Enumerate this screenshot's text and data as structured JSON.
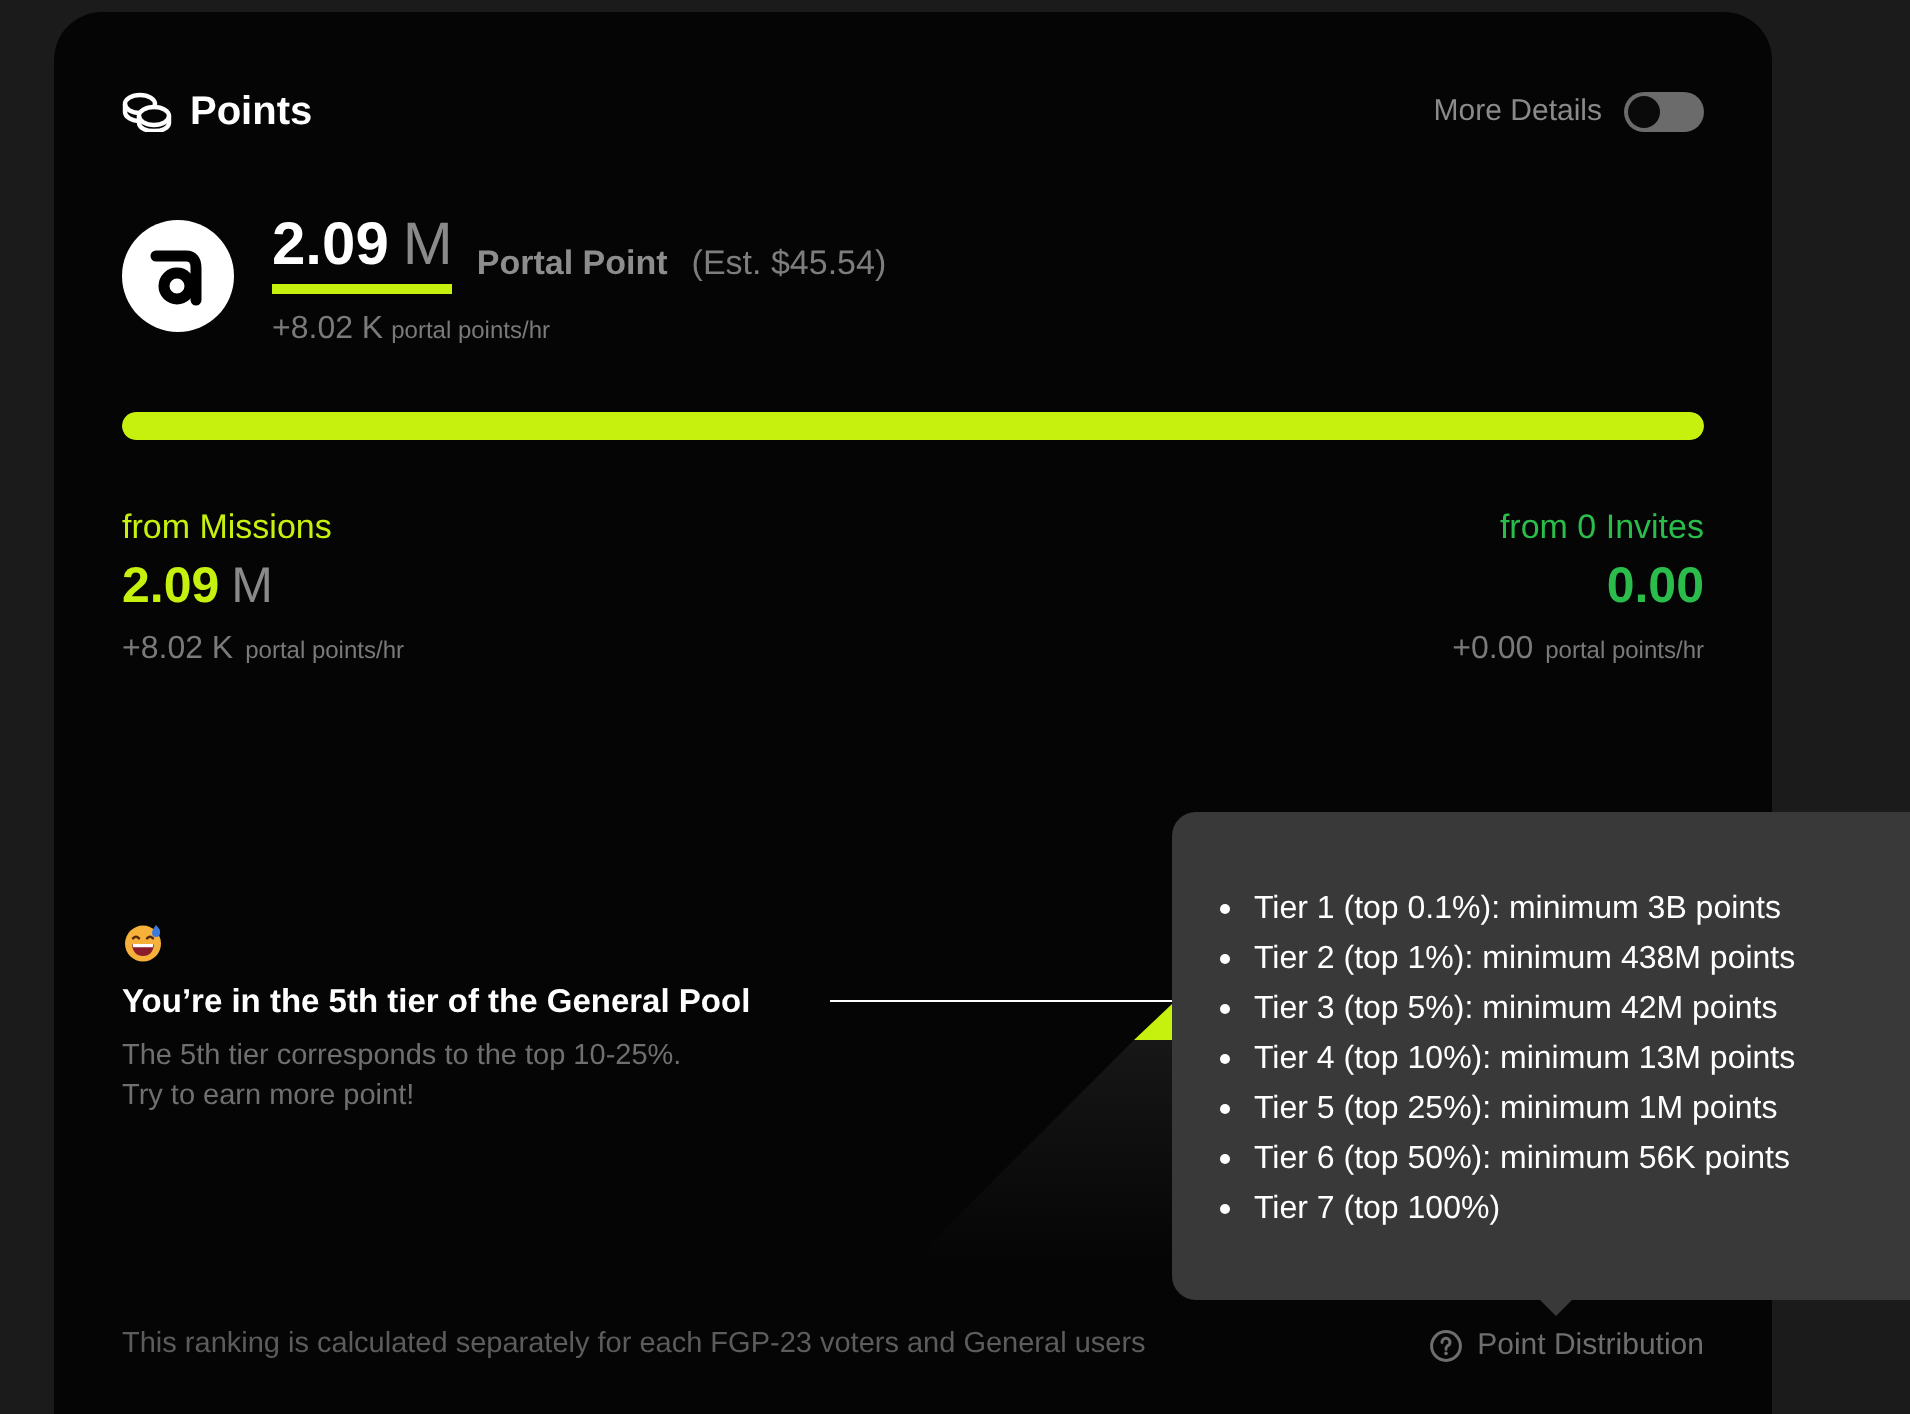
{
  "header": {
    "title": "Points",
    "toggle": {
      "label": "More Details",
      "on": false
    }
  },
  "balance": {
    "value": "2.09",
    "unit": "M",
    "label": "Portal Point",
    "estimate": "(Est. $45.54)",
    "rate": "+8.02 K",
    "rate_unit": "portal points/hr"
  },
  "progress": {
    "level": 1
  },
  "sources": [
    {
      "kind": "missions",
      "label": "from Missions",
      "color": "#c6f10e",
      "value": "2.09",
      "unit": "M",
      "rate": "+8.02 K",
      "rate_unit": "portal points/hr"
    },
    {
      "kind": "invites",
      "label": "from 0 Invites",
      "color": "#2bbd4c",
      "value": "0.00",
      "rate": "+0.00",
      "rate_unit": "portal points/hr"
    }
  ],
  "tier": {
    "title": "You’re in the 5th tier of the General Pool",
    "description": "The 5th tier corresponds to the top 10-25%.\nTry to earn more point!"
  },
  "tooltip": {
    "items": [
      "Tier 1 (top 0.1%): minimum 3B points",
      "Tier 2 (top 1%): minimum 438M points",
      "Tier 3 (top 5%): minimum 42M points",
      "Tier 4 (top 10%): minimum 13M points",
      "Tier 5 (top 25%): minimum 1M points",
      "Tier 6 (top 50%): minimum 56K points",
      "Tier 7 (top 100%)"
    ]
  },
  "footer": {
    "note": "This ranking is calculated separately for each FGP-23 voters and General users",
    "link": "Point Distribution"
  }
}
